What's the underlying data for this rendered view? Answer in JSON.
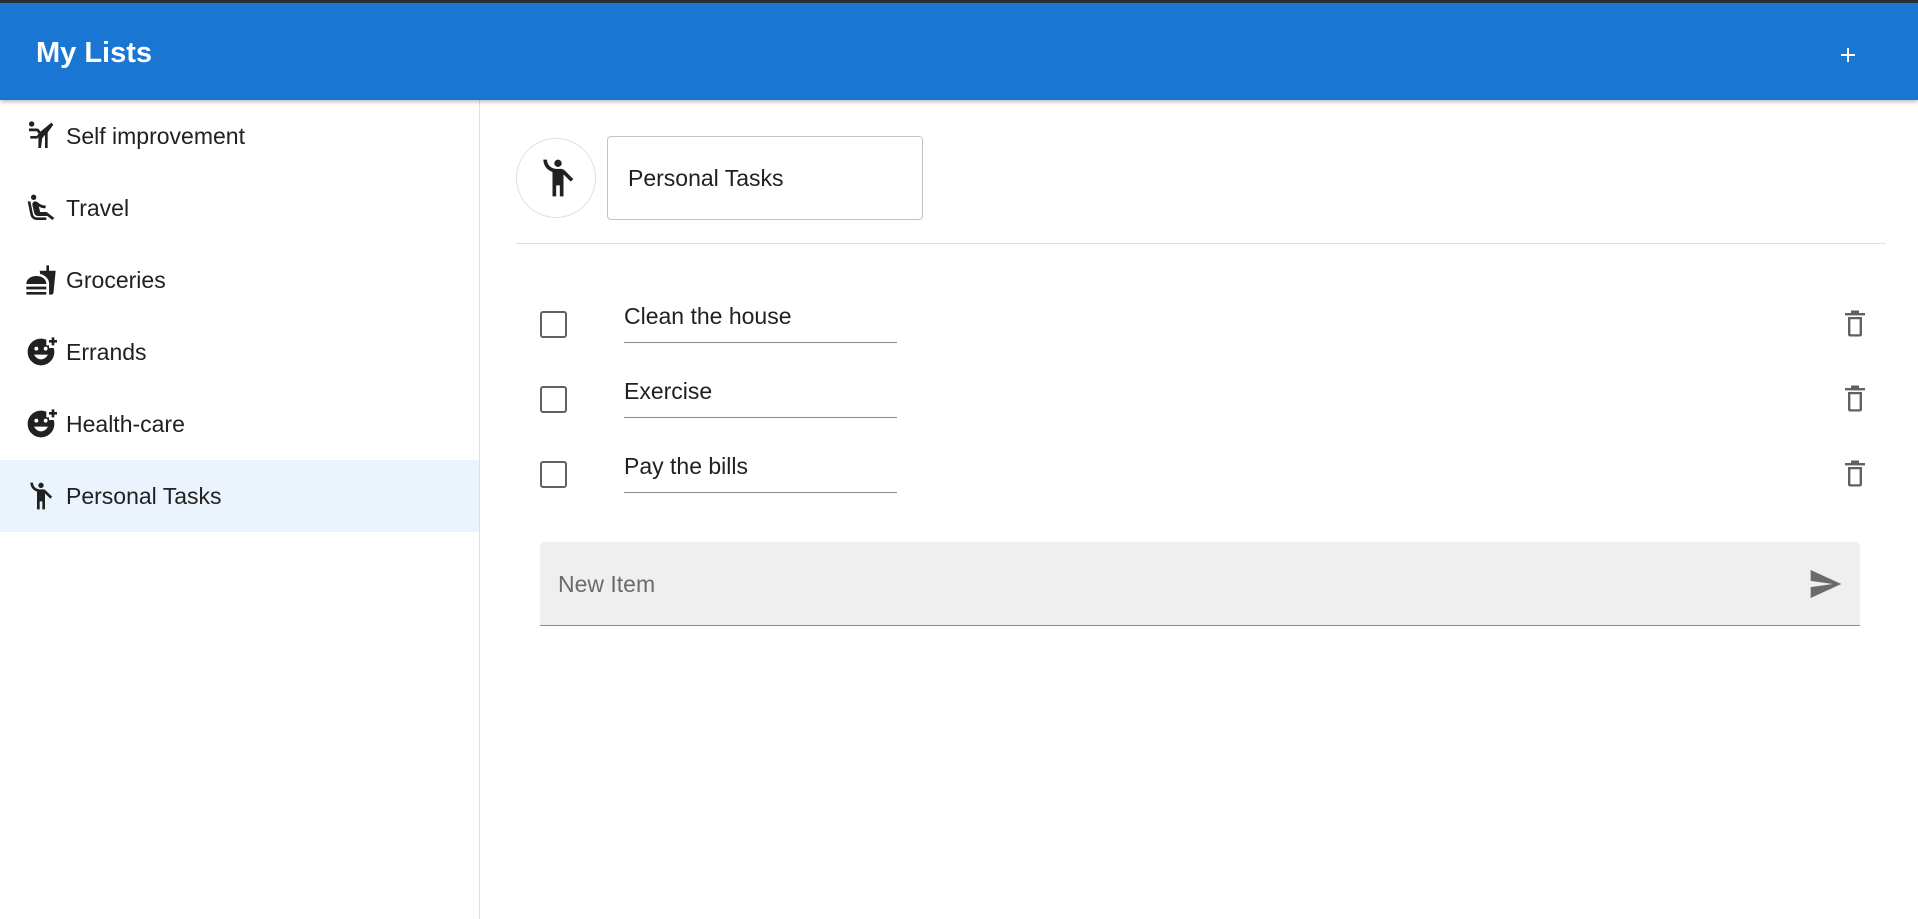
{
  "app": {
    "title": "My Lists",
    "accent_color": "#1976d2",
    "add_icon": "plus-icon"
  },
  "sidebar": {
    "items": [
      {
        "label": "Self improvement",
        "icon": "sports-martial-arts-icon",
        "active": false
      },
      {
        "label": "Travel",
        "icon": "airline-seat-icon",
        "active": false
      },
      {
        "label": "Groceries",
        "icon": "fastfood-icon",
        "active": false
      },
      {
        "label": "Errands",
        "icon": "add-reaction-icon",
        "active": false
      },
      {
        "label": "Health-care",
        "icon": "add-reaction-icon",
        "active": false
      },
      {
        "label": "Personal Tasks",
        "icon": "emoji-people-icon",
        "active": true
      }
    ],
    "active_background": "#ebf3fc"
  },
  "list": {
    "icon": "emoji-people-icon",
    "title_value": "Personal Tasks",
    "items": [
      {
        "text": "Clean the house",
        "checked": false
      },
      {
        "text": "Exercise",
        "checked": false
      },
      {
        "text": "Pay the bills",
        "checked": false
      }
    ],
    "new_item_placeholder": "New Item",
    "new_item_value": "",
    "send_icon": "send-icon",
    "delete_icon": "delete-icon"
  }
}
